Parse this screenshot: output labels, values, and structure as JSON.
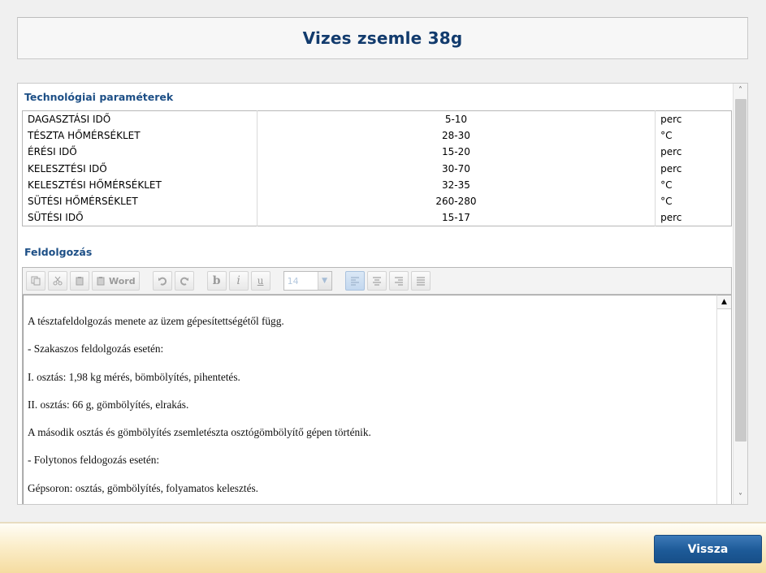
{
  "title": "Vizes zsemle 38g",
  "params_section": {
    "heading": "Technológiai paraméterek",
    "rows": [
      {
        "name": "DAGASZTÁSI IDŐ",
        "value": "5-10",
        "unit": "perc"
      },
      {
        "name": "TÉSZTA HŐMÉRSÉKLET",
        "value": "28-30",
        "unit": "°C"
      },
      {
        "name": "ÉRÉSI IDŐ",
        "value": "15-20",
        "unit": "perc"
      },
      {
        "name": "KELESZTÉSI IDŐ",
        "value": "30-70",
        "unit": "perc"
      },
      {
        "name": "KELESZTÉSI HŐMÉRSÉKLET",
        "value": "32-35",
        "unit": "°C"
      },
      {
        "name": "SÜTÉSI HŐMÉRSÉKLET",
        "value": "260-280",
        "unit": "°C"
      },
      {
        "name": "SÜTÉSI IDŐ",
        "value": "15-17",
        "unit": "perc"
      }
    ]
  },
  "processing_section": {
    "heading": "Feldolgozás",
    "toolbar": {
      "word_label": "Word",
      "bold_label": "b",
      "italic_label": "i",
      "underline_label": "u",
      "font_size": "14"
    },
    "paragraphs": [
      "A tésztafeldolgozás menete az üzem gépesítettségétől függ.",
      "- Szakaszos feldolgozás esetén:",
      "I. osztás: 1,98 kg mérés, bömbölyítés, pihentetés.",
      "II. osztás: 66 g, gömbölyítés, elrakás.",
      "A második osztás és gömbölyítés zsemletészta osztógömbölyítő gépen történik.",
      "- Folytonos feldogozás esetén:",
      "Gépsoron: osztás, gömbölyítés, folyamatos kelesztés."
    ]
  },
  "footer": {
    "back_label": "Vissza"
  }
}
